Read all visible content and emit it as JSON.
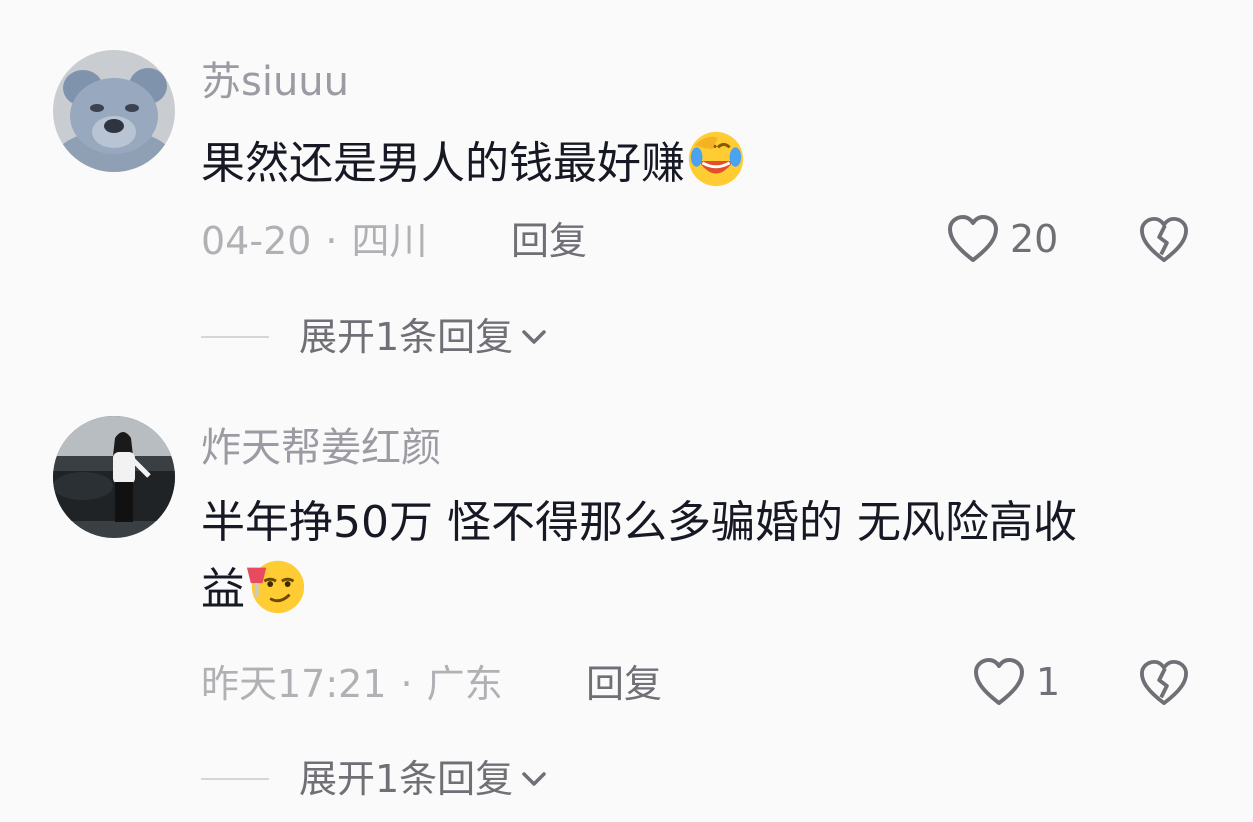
{
  "comments": [
    {
      "username": "苏siuuu",
      "text": "果然还是男人的钱最好赚",
      "emoji": "crying-laughing-emoji",
      "date": "04-20",
      "location": "四川",
      "reply_label": "回复",
      "like_count": "20",
      "expand_label": "展开1条回复"
    },
    {
      "username": "炸天帮姜红颜",
      "text_line1": "半年挣50万 怪不得那么多骗婚的 无风险高收",
      "text_line2": "益",
      "emoji": "smirk-wine-emoji",
      "date": "昨天17:21",
      "location": "广东",
      "reply_label": "回复",
      "like_count": "1",
      "expand_label": "展开1条回复"
    }
  ],
  "separator": "·",
  "colors": {
    "background": "#fafafa",
    "text_primary": "#161823",
    "text_secondary": "#9b9ba3",
    "meta": "#b0b0b5",
    "icon": "#6f6f76"
  }
}
